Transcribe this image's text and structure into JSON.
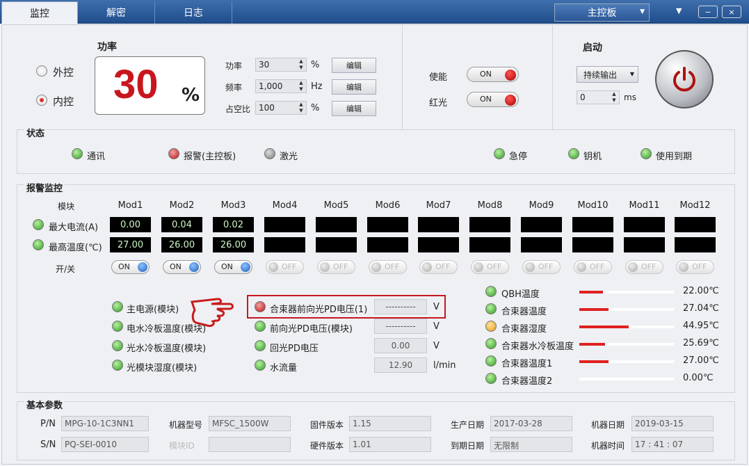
{
  "tabs": [
    "监控",
    "解密",
    "日志"
  ],
  "board_select": "主控板",
  "window_buttons": [
    "▼",
    "−",
    "×"
  ],
  "control": {
    "ext_label": "外控",
    "int_label": "内控",
    "selected": "内控"
  },
  "power_box": {
    "title": "功率",
    "value": "30",
    "unit": "%"
  },
  "params": [
    {
      "label": "功率",
      "value": "30",
      "unit": "%",
      "button": "编辑"
    },
    {
      "label": "频率",
      "value": "1,000",
      "unit": "Hz",
      "button": "编辑"
    },
    {
      "label": "占空比",
      "value": "100",
      "unit": "%",
      "button": "编辑"
    }
  ],
  "switches": [
    {
      "label": "使能",
      "state": "ON"
    },
    {
      "label": "红光",
      "state": "ON"
    }
  ],
  "start": {
    "title": "启动",
    "mode": "持续输出",
    "delay": "0",
    "delay_unit": "ms"
  },
  "status": {
    "title": "状态",
    "items": [
      {
        "label": "通讯",
        "color": "g"
      },
      {
        "label": "报警(主控板)",
        "color": "r"
      },
      {
        "label": "激光",
        "color": "gr"
      },
      {
        "label": "急停",
        "color": "g"
      },
      {
        "label": "钥机",
        "color": "g"
      },
      {
        "label": "使用到期",
        "color": "g"
      }
    ]
  },
  "alarm": {
    "title": "报警监控",
    "module_header": "模块",
    "onoff_label": "开/关",
    "modules": [
      "Mod1",
      "Mod2",
      "Mod3",
      "Mod4",
      "Mod5",
      "Mod6",
      "Mod7",
      "Mod8",
      "Mod9",
      "Mod10",
      "Mod11",
      "Mod12"
    ],
    "row1_label": "最大电流(A)",
    "row1": [
      "0.00",
      "0.04",
      "0.02",
      "",
      "",
      "",
      "",
      "",
      "",
      "",
      "",
      ""
    ],
    "row2_label": "最高温度(℃)",
    "row2": [
      "27.00",
      "26.00",
      "26.00",
      "",
      "",
      "",
      "",
      "",
      "",
      "",
      "",
      ""
    ],
    "switch_states": [
      "ON",
      "ON",
      "ON",
      "OFF",
      "OFF",
      "OFF",
      "OFF",
      "OFF",
      "OFF",
      "OFF",
      "OFF",
      "OFF"
    ]
  },
  "checks_col1": [
    "主电源(模块)",
    "电水冷板温度(模块)",
    "光水冷板温度(模块)",
    "光模块湿度(模块)"
  ],
  "checks_col2": [
    {
      "label": "合束器前向光PD电压(1)",
      "value": "----------",
      "unit": "V",
      "color": "r"
    },
    {
      "label": "前向光PD电压(模块)",
      "value": "----------",
      "unit": "V",
      "color": "g"
    },
    {
      "label": "回光PD电压",
      "value": "0.00",
      "unit": "V",
      "color": "g"
    },
    {
      "label": "水流量",
      "value": "12.90",
      "unit": "l/min",
      "color": "g"
    }
  ],
  "temps": [
    {
      "label": "QBH温度",
      "value": "22.00℃",
      "fill": 0.25,
      "color": "g"
    },
    {
      "label": "合束器温度",
      "value": "27.04℃",
      "fill": 0.31,
      "color": "g"
    },
    {
      "label": "合束器湿度",
      "value": "44.95℃",
      "fill": 0.52,
      "color": "o"
    },
    {
      "label": "合束器水冷板温度",
      "value": "25.69℃",
      "fill": 0.27,
      "color": "g"
    },
    {
      "label": "合束器温度1",
      "value": "27.00℃",
      "fill": 0.31,
      "color": "g"
    },
    {
      "label": "合束器温度2",
      "value": "0.00℃",
      "fill": 0.0,
      "color": "g"
    }
  ],
  "basic": {
    "title": "基本参数",
    "pn_label": "P/N",
    "pn": "MPG-10-1C3NN1",
    "sn_label": "S/N",
    "sn": "PQ-SEI-0010",
    "model_label": "机器型号",
    "model": "MFSC_1500W",
    "module_id_label": "模块ID",
    "module_id": "",
    "fw_label": "固件版本",
    "fw": "1.15",
    "hw_label": "硬件版本",
    "hw": "1.01",
    "prod_label": "生产日期",
    "prod": "2017-03-28",
    "exp_label": "到期日期",
    "exp": "无限制",
    "mdate_label": "机器日期",
    "mdate": "2019-03-15",
    "mtime_label": "机器时间",
    "mtime": "17 : 41 : 07"
  }
}
